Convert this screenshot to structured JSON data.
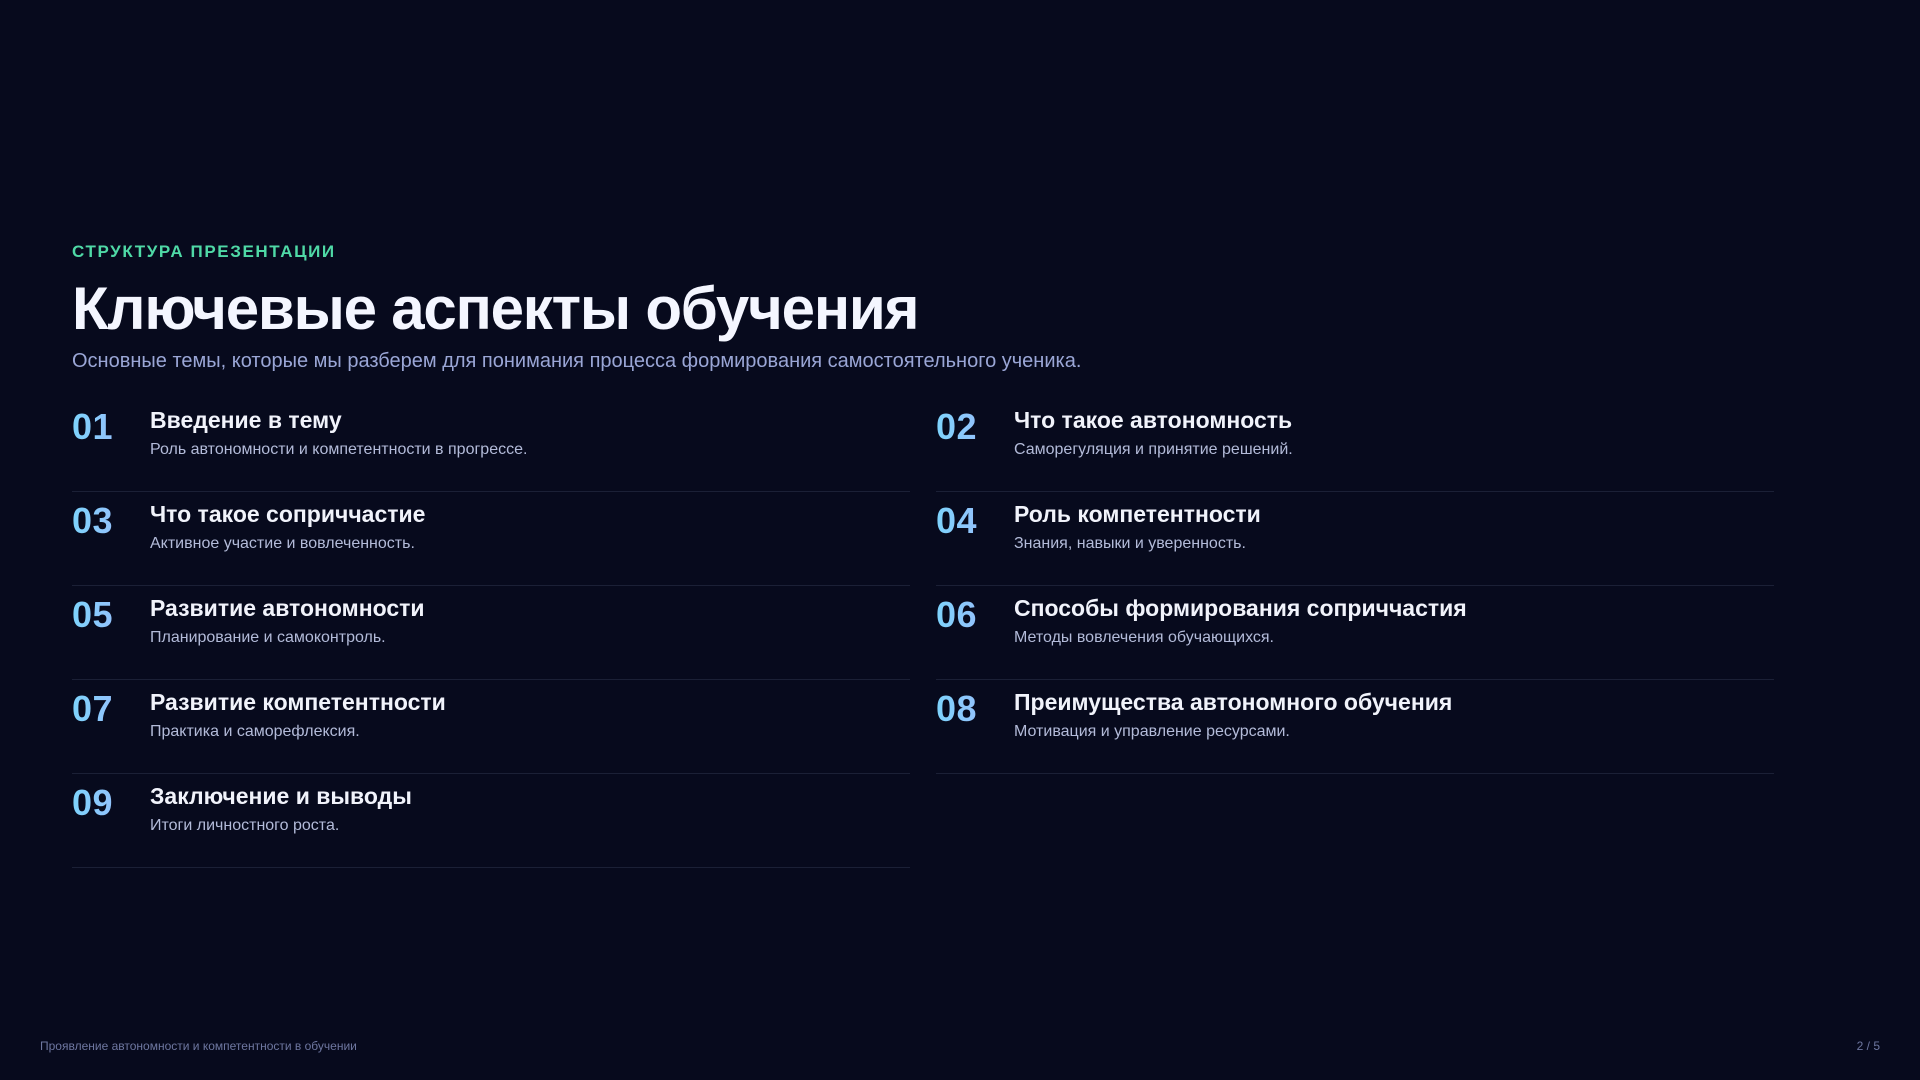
{
  "slide": {
    "eyebrow": "СТРУКТУРА ПРЕЗЕНТАЦИИ",
    "title": "Ключевые аспекты обучения",
    "subtitle": "Основные темы, которые мы разберем для понимания процесса формирования самостоятельного ученика.",
    "items": [
      {
        "num": "01",
        "title": "Введение в тему",
        "desc": "Роль автономности и компетентности в прогрессе."
      },
      {
        "num": "02",
        "title": "Что такое автономность",
        "desc": "Саморегуляция и принятие решений."
      },
      {
        "num": "03",
        "title": "Что такое соприччастие",
        "desc": "Активное участие и вовлеченность."
      },
      {
        "num": "04",
        "title": "Роль компетентности",
        "desc": "Знания, навыки и уверенность."
      },
      {
        "num": "05",
        "title": "Развитие автономности",
        "desc": "Планирование и самоконтроль."
      },
      {
        "num": "06",
        "title": "Способы формирования соприччастия",
        "desc": "Методы вовлечения обучающихся."
      },
      {
        "num": "07",
        "title": "Развитие компетентности",
        "desc": "Практика и саморефлексия."
      },
      {
        "num": "08",
        "title": "Преимущества автономного обучения",
        "desc": "Мотивация и управление ресурсами."
      },
      {
        "num": "09",
        "title": "Заключение и выводы",
        "desc": "Итоги личностного роста."
      }
    ]
  },
  "footer": {
    "left": "Проявление автономности и компетентности в обучении",
    "page": "2 / 5"
  },
  "colors": {
    "background": "#070a1d",
    "eyebrow": "#4fd9a6",
    "number_gradient_start": "#7dd3fc",
    "number_gradient_end": "#a5b4fc"
  }
}
